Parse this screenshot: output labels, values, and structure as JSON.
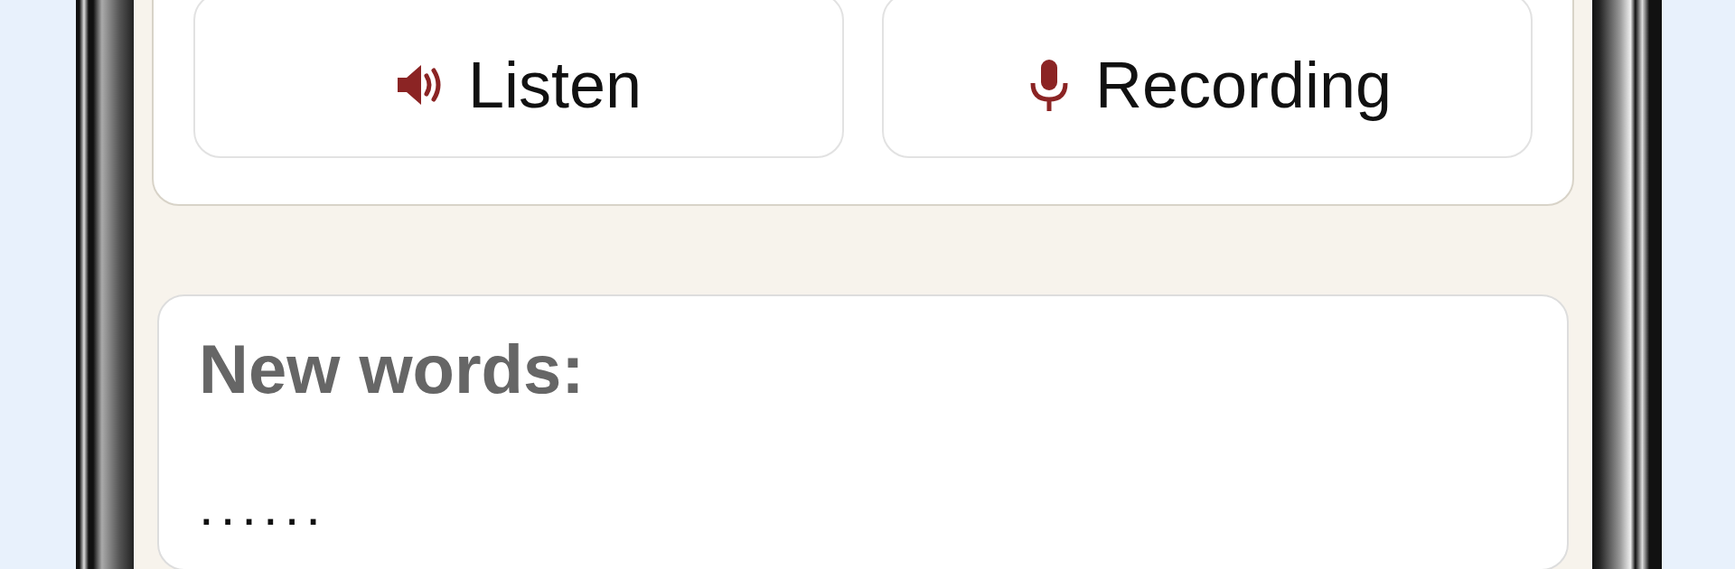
{
  "buttons": [
    {
      "label": "Listen",
      "kind": "speaker"
    },
    {
      "label": "Recording",
      "kind": "microphone"
    }
  ],
  "new_words": {
    "heading": "New words:",
    "content": "......"
  }
}
